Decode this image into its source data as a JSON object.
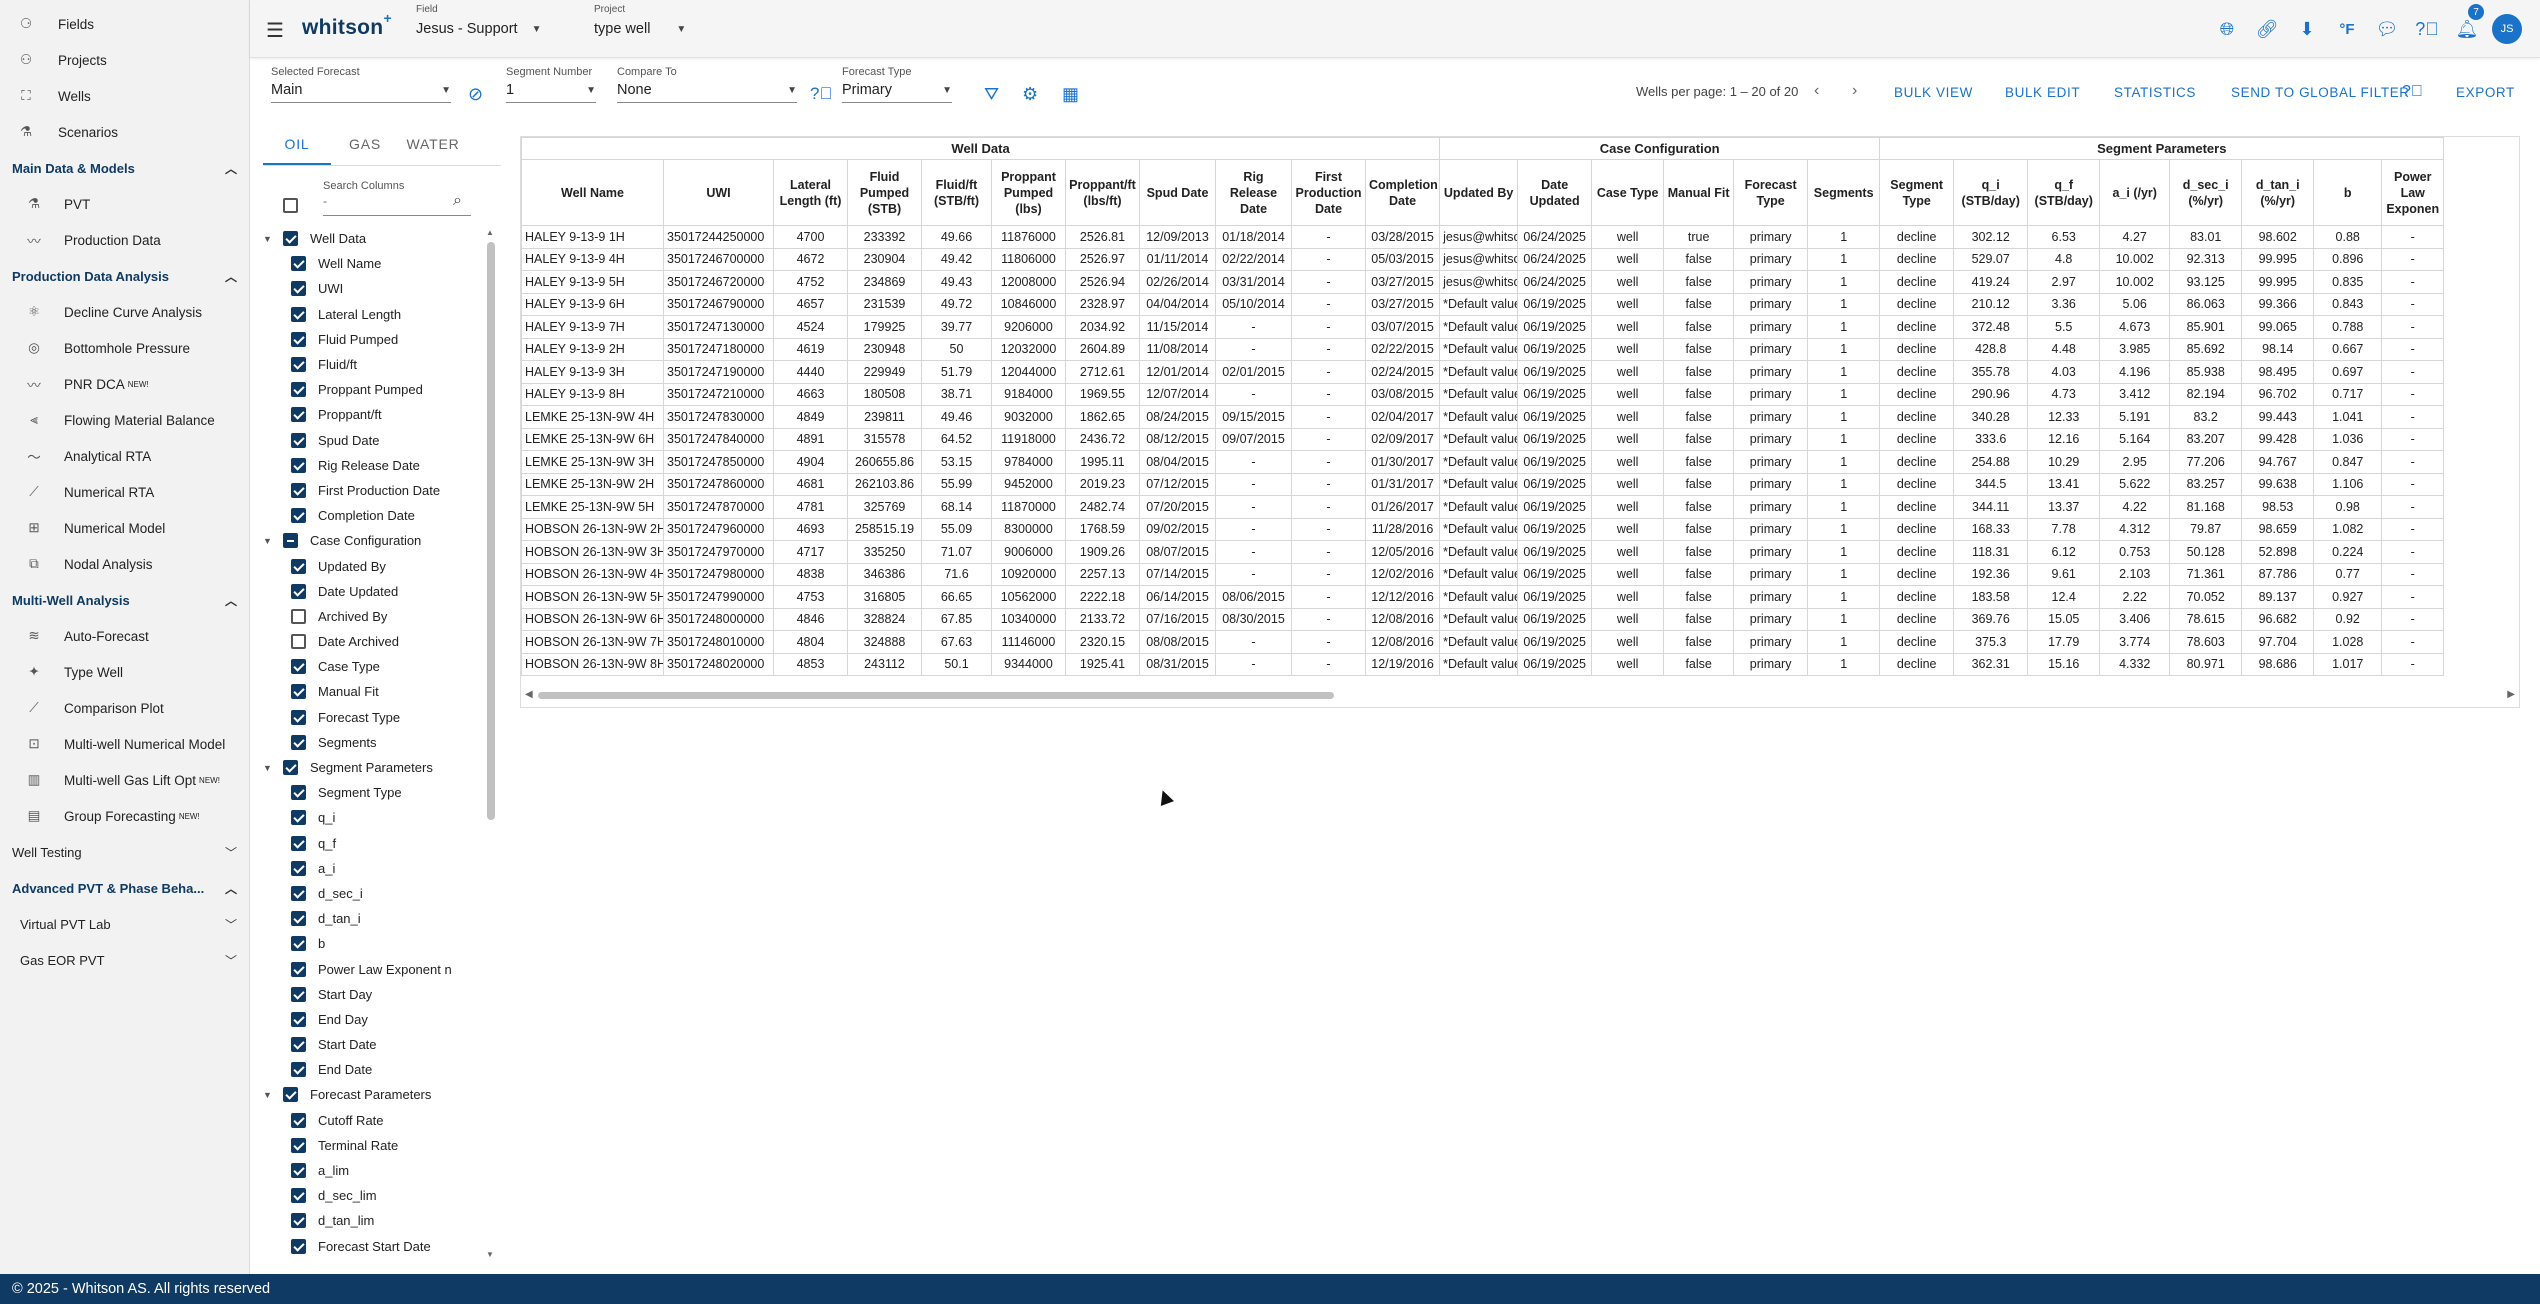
{
  "sidebar": {
    "top_items": [
      {
        "label": "Fields",
        "icon": "fields-icon"
      },
      {
        "label": "Projects",
        "icon": "projects-icon"
      },
      {
        "label": "Wells",
        "icon": "wells-icon"
      },
      {
        "label": "Scenarios",
        "icon": "scenarios-icon"
      }
    ],
    "sections": [
      {
        "label": "Main Data & Models",
        "expanded": true,
        "items": [
          {
            "label": "PVT",
            "new": ""
          },
          {
            "label": "Production Data",
            "new": ""
          }
        ]
      },
      {
        "label": "Production Data Analysis",
        "expanded": true,
        "items": [
          {
            "label": "Decline Curve Analysis",
            "new": ""
          },
          {
            "label": "Bottomhole Pressure",
            "new": ""
          },
          {
            "label": "PNR DCA",
            "new": "NEW!"
          },
          {
            "label": "Flowing Material Balance",
            "new": ""
          },
          {
            "label": "Analytical RTA",
            "new": ""
          },
          {
            "label": "Numerical RTA",
            "new": ""
          },
          {
            "label": "Numerical Model",
            "new": ""
          },
          {
            "label": "Nodal Analysis",
            "new": ""
          }
        ]
      },
      {
        "label": "Multi-Well Analysis",
        "expanded": true,
        "items": [
          {
            "label": "Auto-Forecast",
            "new": ""
          },
          {
            "label": "Type Well",
            "new": ""
          },
          {
            "label": "Comparison Plot",
            "new": ""
          },
          {
            "label": "Multi-well Numerical Model",
            "new": ""
          },
          {
            "label": "Multi-well Gas Lift Opt",
            "new": "NEW!"
          },
          {
            "label": "Group Forecasting",
            "new": "NEW!"
          }
        ]
      }
    ],
    "well_testing": "Well Testing",
    "adv_pvt": "Advanced PVT & Phase Beha...",
    "virtual_pvt": "Virtual PVT Lab",
    "gas_eor": "Gas EOR PVT"
  },
  "footer": "© 2025 - Whitson AS. All rights reserved",
  "header": {
    "logo": "whitson",
    "logo_plus": "+",
    "field_label": "Field",
    "field_value": "Jesus - Support",
    "project_label": "Project",
    "project_value": "type well",
    "notification_count": "7",
    "avatar_initials": "JS",
    "unit": "°F"
  },
  "toolbar": {
    "selected_forecast_label": "Selected Forecast",
    "selected_forecast": "Main",
    "segment_number_label": "Segment Number",
    "segment_number": "1",
    "compare_to_label": "Compare To",
    "compare_to": "None",
    "forecast_type_label": "Forecast Type",
    "forecast_type": "Primary",
    "wells_per_page": "Wells per page: 1 – 20 of 20",
    "bulk_view": "BULK VIEW",
    "bulk_edit": "BULK EDIT",
    "statistics": "STATISTICS",
    "send_to_global": "SEND TO GLOBAL FILTER",
    "export": "EXPORT"
  },
  "column_panel": {
    "tabs": [
      "OIL",
      "GAS",
      "WATER"
    ],
    "search_label": "Search Columns",
    "search_placeholder": "-",
    "tree": [
      {
        "label": "Well Data",
        "group": true,
        "state": "on"
      },
      {
        "label": "Well Name",
        "state": "on"
      },
      {
        "label": "UWI",
        "state": "on"
      },
      {
        "label": "Lateral Length",
        "state": "on"
      },
      {
        "label": "Fluid Pumped",
        "state": "on"
      },
      {
        "label": "Fluid/ft",
        "state": "on"
      },
      {
        "label": "Proppant Pumped",
        "state": "on"
      },
      {
        "label": "Proppant/ft",
        "state": "on"
      },
      {
        "label": "Spud Date",
        "state": "on"
      },
      {
        "label": "Rig Release Date",
        "state": "on"
      },
      {
        "label": "First Production Date",
        "state": "on"
      },
      {
        "label": "Completion Date",
        "state": "on"
      },
      {
        "label": "Case Configuration",
        "group": true,
        "state": "ind"
      },
      {
        "label": "Updated By",
        "state": "on"
      },
      {
        "label": "Date Updated",
        "state": "on"
      },
      {
        "label": "Archived By",
        "state": "off"
      },
      {
        "label": "Date Archived",
        "state": "off"
      },
      {
        "label": "Case Type",
        "state": "on"
      },
      {
        "label": "Manual Fit",
        "state": "on"
      },
      {
        "label": "Forecast Type",
        "state": "on"
      },
      {
        "label": "Segments",
        "state": "on"
      },
      {
        "label": "Segment Parameters",
        "group": true,
        "state": "on"
      },
      {
        "label": "Segment Type",
        "state": "on"
      },
      {
        "label": "q_i",
        "state": "on"
      },
      {
        "label": "q_f",
        "state": "on"
      },
      {
        "label": "a_i",
        "state": "on"
      },
      {
        "label": "d_sec_i",
        "state": "on"
      },
      {
        "label": "d_tan_i",
        "state": "on"
      },
      {
        "label": "b",
        "state": "on"
      },
      {
        "label": "Power Law Exponent n",
        "state": "on"
      },
      {
        "label": "Start Day",
        "state": "on"
      },
      {
        "label": "End Day",
        "state": "on"
      },
      {
        "label": "Start Date",
        "state": "on"
      },
      {
        "label": "End Date",
        "state": "on"
      },
      {
        "label": "Forecast Parameters",
        "group": true,
        "state": "on"
      },
      {
        "label": "Cutoff Rate",
        "state": "on"
      },
      {
        "label": "Terminal Rate",
        "state": "on"
      },
      {
        "label": "a_lim",
        "state": "on"
      },
      {
        "label": "d_sec_lim",
        "state": "on"
      },
      {
        "label": "d_tan_lim",
        "state": "on"
      },
      {
        "label": "Forecast Start Date",
        "state": "on"
      }
    ]
  },
  "table": {
    "groups": [
      {
        "label": "Well Data",
        "span": 11
      },
      {
        "label": "Case Configuration",
        "span": 6
      },
      {
        "label": "Segment Parameters",
        "span": 8
      }
    ],
    "columns": [
      "Well Name",
      "UWI",
      "Lateral Length (ft)",
      "Fluid Pumped (STB)",
      "Fluid/ft (STB/ft)",
      "Proppant Pumped (lbs)",
      "Proppant/ft (lbs/ft)",
      "Spud Date",
      "Rig Release Date",
      "First Production Date",
      "Completion Date",
      "Updated By",
      "Date Updated",
      "Case Type",
      "Manual Fit",
      "Forecast Type",
      "Segments",
      "Segment Type",
      "q_i (STB/day)",
      "q_f (STB/day)",
      "a_i (/yr)",
      "d_sec_i (%/yr)",
      "d_tan_i (%/yr)",
      "b",
      "Power Law Exponen"
    ],
    "rows": [
      [
        "HALEY 9-13-9 1H",
        "35017244250000",
        "4700",
        "233392",
        "49.66",
        "11876000",
        "2526.81",
        "12/09/2013",
        "01/18/2014",
        "-",
        "03/28/2015",
        "jesus@whitson",
        "06/24/2025",
        "well",
        "true",
        "primary",
        "1",
        "decline",
        "302.12",
        "6.53",
        "4.27",
        "83.01",
        "98.602",
        "0.88",
        "-"
      ],
      [
        "HALEY 9-13-9 4H",
        "35017246700000",
        "4672",
        "230904",
        "49.42",
        "11806000",
        "2526.97",
        "01/11/2014",
        "02/22/2014",
        "-",
        "05/03/2015",
        "jesus@whitson",
        "06/24/2025",
        "well",
        "false",
        "primary",
        "1",
        "decline",
        "529.07",
        "4.8",
        "10.002",
        "92.313",
        "99.995",
        "0.896",
        "-"
      ],
      [
        "HALEY 9-13-9 5H",
        "35017246720000",
        "4752",
        "234869",
        "49.43",
        "12008000",
        "2526.94",
        "02/26/2014",
        "03/31/2014",
        "-",
        "03/27/2015",
        "jesus@whitson",
        "06/24/2025",
        "well",
        "false",
        "primary",
        "1",
        "decline",
        "419.24",
        "2.97",
        "10.002",
        "93.125",
        "99.995",
        "0.835",
        "-"
      ],
      [
        "HALEY 9-13-9 6H",
        "35017246790000",
        "4657",
        "231539",
        "49.72",
        "10846000",
        "2328.97",
        "04/04/2014",
        "05/10/2014",
        "-",
        "03/27/2015",
        "*Default value",
        "06/19/2025",
        "well",
        "false",
        "primary",
        "1",
        "decline",
        "210.12",
        "3.36",
        "5.06",
        "86.063",
        "99.366",
        "0.843",
        "-"
      ],
      [
        "HALEY 9-13-9 7H",
        "35017247130000",
        "4524",
        "179925",
        "39.77",
        "9206000",
        "2034.92",
        "11/15/2014",
        "-",
        "-",
        "03/07/2015",
        "*Default value",
        "06/19/2025",
        "well",
        "false",
        "primary",
        "1",
        "decline",
        "372.48",
        "5.5",
        "4.673",
        "85.901",
        "99.065",
        "0.788",
        "-"
      ],
      [
        "HALEY 9-13-9 2H",
        "35017247180000",
        "4619",
        "230948",
        "50",
        "12032000",
        "2604.89",
        "11/08/2014",
        "-",
        "-",
        "02/22/2015",
        "*Default value",
        "06/19/2025",
        "well",
        "false",
        "primary",
        "1",
        "decline",
        "428.8",
        "4.48",
        "3.985",
        "85.692",
        "98.14",
        "0.667",
        "-"
      ],
      [
        "HALEY 9-13-9 3H",
        "35017247190000",
        "4440",
        "229949",
        "51.79",
        "12044000",
        "2712.61",
        "12/01/2014",
        "02/01/2015",
        "-",
        "02/24/2015",
        "*Default value",
        "06/19/2025",
        "well",
        "false",
        "primary",
        "1",
        "decline",
        "355.78",
        "4.03",
        "4.196",
        "85.938",
        "98.495",
        "0.697",
        "-"
      ],
      [
        "HALEY 9-13-9 8H",
        "35017247210000",
        "4663",
        "180508",
        "38.71",
        "9184000",
        "1969.55",
        "12/07/2014",
        "-",
        "-",
        "03/08/2015",
        "*Default value",
        "06/19/2025",
        "well",
        "false",
        "primary",
        "1",
        "decline",
        "290.96",
        "4.73",
        "3.412",
        "82.194",
        "96.702",
        "0.717",
        "-"
      ],
      [
        "LEMKE 25-13N-9W 4H",
        "35017247830000",
        "4849",
        "239811",
        "49.46",
        "9032000",
        "1862.65",
        "08/24/2015",
        "09/15/2015",
        "-",
        "02/04/2017",
        "*Default value",
        "06/19/2025",
        "well",
        "false",
        "primary",
        "1",
        "decline",
        "340.28",
        "12.33",
        "5.191",
        "83.2",
        "99.443",
        "1.041",
        "-"
      ],
      [
        "LEMKE 25-13N-9W 6H",
        "35017247840000",
        "4891",
        "315578",
        "64.52",
        "11918000",
        "2436.72",
        "08/12/2015",
        "09/07/2015",
        "-",
        "02/09/2017",
        "*Default value",
        "06/19/2025",
        "well",
        "false",
        "primary",
        "1",
        "decline",
        "333.6",
        "12.16",
        "5.164",
        "83.207",
        "99.428",
        "1.036",
        "-"
      ],
      [
        "LEMKE 25-13N-9W 3H",
        "35017247850000",
        "4904",
        "260655.86",
        "53.15",
        "9784000",
        "1995.11",
        "08/04/2015",
        "-",
        "-",
        "01/30/2017",
        "*Default value",
        "06/19/2025",
        "well",
        "false",
        "primary",
        "1",
        "decline",
        "254.88",
        "10.29",
        "2.95",
        "77.206",
        "94.767",
        "0.847",
        "-"
      ],
      [
        "LEMKE 25-13N-9W 2H",
        "35017247860000",
        "4681",
        "262103.86",
        "55.99",
        "9452000",
        "2019.23",
        "07/12/2015",
        "-",
        "-",
        "01/31/2017",
        "*Default value",
        "06/19/2025",
        "well",
        "false",
        "primary",
        "1",
        "decline",
        "344.5",
        "13.41",
        "5.622",
        "83.257",
        "99.638",
        "1.106",
        "-"
      ],
      [
        "LEMKE 25-13N-9W 5H",
        "35017247870000",
        "4781",
        "325769",
        "68.14",
        "11870000",
        "2482.74",
        "07/20/2015",
        "-",
        "-",
        "01/26/2017",
        "*Default value",
        "06/19/2025",
        "well",
        "false",
        "primary",
        "1",
        "decline",
        "344.11",
        "13.37",
        "4.22",
        "81.168",
        "98.53",
        "0.98",
        "-"
      ],
      [
        "HOBSON 26-13N-9W 2H",
        "35017247960000",
        "4693",
        "258515.19",
        "55.09",
        "8300000",
        "1768.59",
        "09/02/2015",
        "-",
        "-",
        "11/28/2016",
        "*Default value",
        "06/19/2025",
        "well",
        "false",
        "primary",
        "1",
        "decline",
        "168.33",
        "7.78",
        "4.312",
        "79.87",
        "98.659",
        "1.082",
        "-"
      ],
      [
        "HOBSON 26-13N-9W 3H",
        "35017247970000",
        "4717",
        "335250",
        "71.07",
        "9006000",
        "1909.26",
        "08/07/2015",
        "-",
        "-",
        "12/05/2016",
        "*Default value",
        "06/19/2025",
        "well",
        "false",
        "primary",
        "1",
        "decline",
        "118.31",
        "6.12",
        "0.753",
        "50.128",
        "52.898",
        "0.224",
        "-"
      ],
      [
        "HOBSON 26-13N-9W 4H",
        "35017247980000",
        "4838",
        "346386",
        "71.6",
        "10920000",
        "2257.13",
        "07/14/2015",
        "-",
        "-",
        "12/02/2016",
        "*Default value",
        "06/19/2025",
        "well",
        "false",
        "primary",
        "1",
        "decline",
        "192.36",
        "9.61",
        "2.103",
        "71.361",
        "87.786",
        "0.77",
        "-"
      ],
      [
        "HOBSON 26-13N-9W 5H",
        "35017247990000",
        "4753",
        "316805",
        "66.65",
        "10562000",
        "2222.18",
        "06/14/2015",
        "08/06/2015",
        "-",
        "12/12/2016",
        "*Default value",
        "06/19/2025",
        "well",
        "false",
        "primary",
        "1",
        "decline",
        "183.58",
        "12.4",
        "2.22",
        "70.052",
        "89.137",
        "0.927",
        "-"
      ],
      [
        "HOBSON 26-13N-9W 6H",
        "35017248000000",
        "4846",
        "328824",
        "67.85",
        "10340000",
        "2133.72",
        "07/16/2015",
        "08/30/2015",
        "-",
        "12/08/2016",
        "*Default value",
        "06/19/2025",
        "well",
        "false",
        "primary",
        "1",
        "decline",
        "369.76",
        "15.05",
        "3.406",
        "78.615",
        "96.682",
        "0.92",
        "-"
      ],
      [
        "HOBSON 26-13N-9W 7H",
        "35017248010000",
        "4804",
        "324888",
        "67.63",
        "11146000",
        "2320.15",
        "08/08/2015",
        "-",
        "-",
        "12/08/2016",
        "*Default value",
        "06/19/2025",
        "well",
        "false",
        "primary",
        "1",
        "decline",
        "375.3",
        "17.79",
        "3.774",
        "78.603",
        "97.704",
        "1.028",
        "-"
      ],
      [
        "HOBSON 26-13N-9W 8H",
        "35017248020000",
        "4853",
        "243112",
        "50.1",
        "9344000",
        "1925.41",
        "08/31/2015",
        "-",
        "-",
        "12/19/2016",
        "*Default value",
        "06/19/2025",
        "well",
        "false",
        "primary",
        "1",
        "decline",
        "362.31",
        "15.16",
        "4.332",
        "80.971",
        "98.686",
        "1.017",
        "-"
      ]
    ]
  }
}
